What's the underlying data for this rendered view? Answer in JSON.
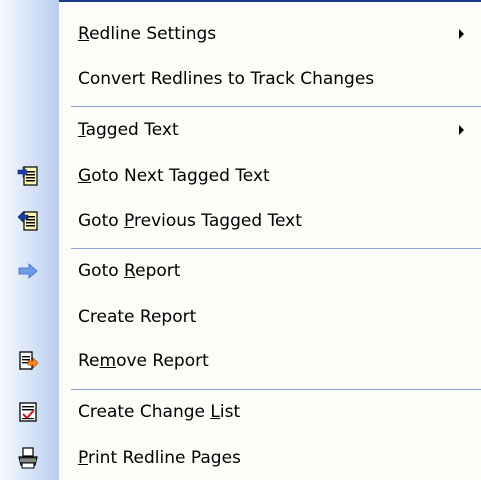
{
  "menu": {
    "items": [
      {
        "pre": "",
        "u": "R",
        "post": "edline Settings",
        "has_submenu": true,
        "icon": ""
      },
      {
        "pre": "Convert Redlines to Track Changes",
        "u": "",
        "post": "",
        "has_submenu": false,
        "icon": ""
      },
      {
        "pre": "",
        "u": "T",
        "post": "agged Text",
        "has_submenu": true,
        "icon": ""
      },
      {
        "pre": "",
        "u": "G",
        "post": "oto Next Tagged Text",
        "has_submenu": false,
        "icon": "next-tagged-text-icon"
      },
      {
        "pre": "Goto ",
        "u": "P",
        "post": "revious Tagged Text",
        "has_submenu": false,
        "icon": "previous-tagged-text-icon"
      },
      {
        "pre": "Goto ",
        "u": "R",
        "post": "eport",
        "has_submenu": false,
        "icon": "right-arrow-icon"
      },
      {
        "pre": "Create Report",
        "u": "",
        "post": "",
        "has_submenu": false,
        "icon": ""
      },
      {
        "pre": "Re",
        "u": "m",
        "post": "ove Report",
        "has_submenu": false,
        "icon": "remove-report-icon"
      },
      {
        "pre": "Create Change ",
        "u": "L",
        "post": "ist",
        "has_submenu": false,
        "icon": "change-list-icon"
      },
      {
        "pre": "",
        "u": "P",
        "post": "rint Redline Pages",
        "has_submenu": false,
        "icon": "printer-icon"
      }
    ]
  },
  "colors": {
    "gutter_dark": "#b9cdef",
    "separator": "#8aa6d8",
    "frame": "#1a3a8a"
  }
}
